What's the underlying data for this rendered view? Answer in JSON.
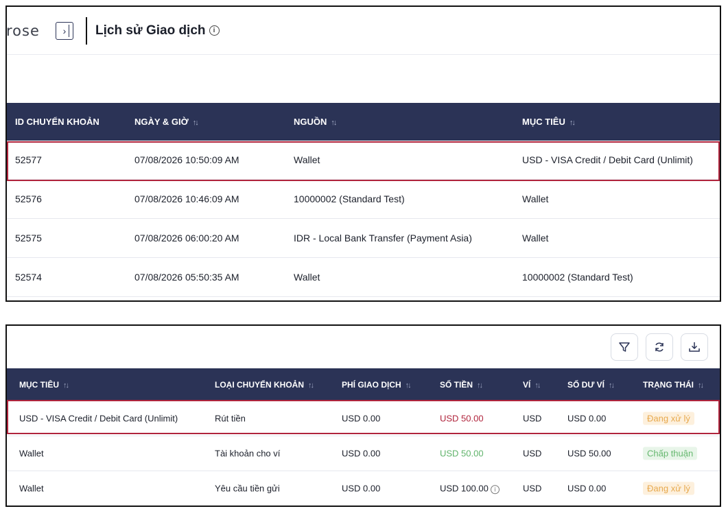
{
  "header": {
    "logo_text": "rose",
    "title": "Lịch sử Giao dịch",
    "info_glyph": "i"
  },
  "table1": {
    "columns": [
      "ID CHUYỂN KHOẢN",
      "NGÀY & GIỜ",
      "NGUỒN",
      "MỤC TIÊU"
    ],
    "sort_glyph": "↑↓",
    "rows": [
      {
        "id": "52577",
        "datetime": "07/08/2026 10:50:09 AM",
        "source": "Wallet",
        "target": "USD - VISA Credit / Debit Card (Unlimit)"
      },
      {
        "id": "52576",
        "datetime": "07/08/2026 10:46:09 AM",
        "source": "10000002 (Standard Test)",
        "target": "Wallet"
      },
      {
        "id": "52575",
        "datetime": "07/08/2026 06:00:20 AM",
        "source": "IDR - Local Bank Transfer (Payment Asia)",
        "target": "Wallet"
      },
      {
        "id": "52574",
        "datetime": "07/08/2026 05:50:35 AM",
        "source": "Wallet",
        "target": "10000002 (Standard Test)"
      }
    ]
  },
  "toolbar": {
    "filter_icon": "filter-icon",
    "refresh_icon": "refresh-icon",
    "download_icon": "download-icon"
  },
  "table2": {
    "columns": [
      "MỤC TIÊU",
      "LOẠI CHUYỂN KHOẢN",
      "PHÍ GIAO DỊCH",
      "SỐ TIỀN",
      "VÍ",
      "SỐ DƯ VÍ",
      "TRẠNG THÁI"
    ],
    "rows": [
      {
        "target": "USD - VISA Credit / Debit Card (Unlimit)",
        "type": "Rút tiền",
        "fee": "USD 0.00",
        "amount": "USD  50.00",
        "wallet": "USD",
        "balance": "USD  0.00",
        "status": "Đang xử lý"
      },
      {
        "target": "Wallet",
        "type": "Tài khoản cho ví",
        "fee": "USD 0.00",
        "amount": "USD  50.00",
        "wallet": "USD",
        "balance": "USD  50.00",
        "status": "Chấp thuận"
      },
      {
        "target": "Wallet",
        "type": "Yêu cầu tiền gửi",
        "fee": "USD 0.00",
        "amount": "USD  100.00",
        "wallet": "USD",
        "balance": "USD  0.00",
        "status": "Đang xử lý"
      }
    ]
  },
  "colors": {
    "header_bg": "#2b3356",
    "highlight": "#b0243c",
    "pending_text": "#e7a94d",
    "approved_text": "#66b86f"
  }
}
